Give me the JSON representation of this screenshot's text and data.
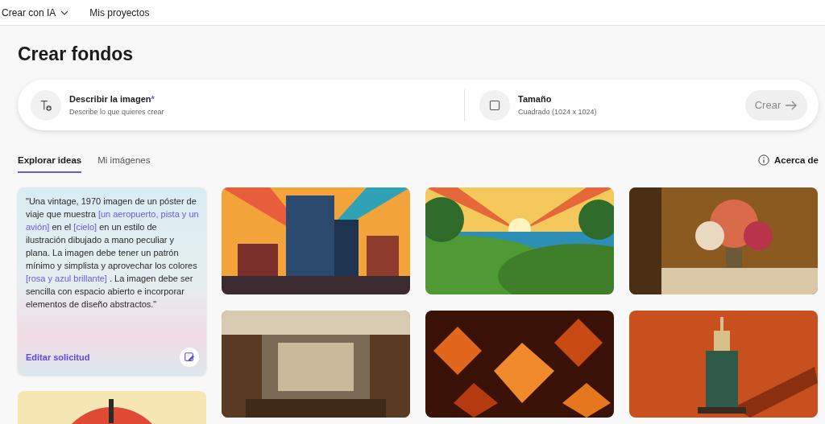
{
  "nav": [
    {
      "label": "Crear con IA",
      "dropdown": true
    },
    {
      "label": "Mis proyectos",
      "dropdown": false
    }
  ],
  "title": "Crear fondos",
  "prompt_bar": {
    "describe": {
      "label": "Describir la imagen",
      "required_mark": "*",
      "placeholder": "Describe lo que quieres crear"
    },
    "size": {
      "label": "Tamaño",
      "value": "Cuadrado (1024 x 1024)"
    },
    "create_button": {
      "label": "Crear",
      "disabled": true
    }
  },
  "tabs": [
    {
      "label": "Explorar ideas",
      "selected": true
    },
    {
      "label": "Mi imágenes",
      "selected": false
    }
  ],
  "about": "Acerca de",
  "idea_card": {
    "segments": [
      {
        "kind": "text",
        "text": "\"Una vintage, 1970 imagen de un póster de viaje que muestra "
      },
      {
        "kind": "highlight",
        "text": "[un aeropuerto, pista y un avión]"
      },
      {
        "kind": "text",
        "text": " en el "
      },
      {
        "kind": "highlight",
        "text": "[cielo]"
      },
      {
        "kind": "text",
        "text": " en un estilo de ilustración dibujado a mano peculiar y plana. La imagen debe tener un patrón mínimo y simplista y aprovechar los colores "
      },
      {
        "kind": "highlight",
        "text": "[rosa y azul brillante]"
      },
      {
        "kind": "text",
        "text": " . La imagen debe ser sencilla con espacio abierto e incorporar elementos de diseño abstractos.\""
      }
    ],
    "edit_link": "Editar solicitud"
  }
}
